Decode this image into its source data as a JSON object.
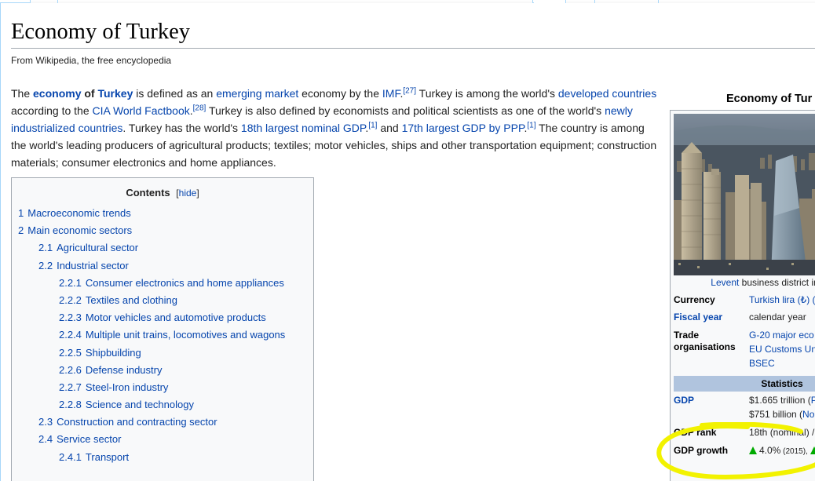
{
  "page": {
    "title": "Economy of Turkey",
    "tagline": "From Wikipedia, the free encyclopedia"
  },
  "lead": {
    "t1": "The ",
    "economy": "economy",
    "of": " of ",
    "turkey": "Turkey",
    "t2": " is defined as an ",
    "emerging_market": "emerging market",
    "t3": " economy by the ",
    "imf": "IMF",
    "ref27": "[27]",
    "t4": " Turkey is among the world's ",
    "developed_countries": "developed countries",
    "t5": " according to the ",
    "cia": "CIA World Factbook",
    "ref28": "[28]",
    "t6": " Turkey is also defined by economists and political scientists as one of the world's ",
    "nic": "newly industrialized countries",
    "t7": ". Turkey has the world's ",
    "nominal": "18th largest nominal GDP",
    "ref1a": "[1]",
    "t8": " and ",
    "ppp": "17th largest GDP by PPP",
    "ref1b": "[1]",
    "t9": " The country is among the world's leading producers of agricultural products; textiles; motor vehicles, ships and other transportation equipment; construction materials; consumer electronics and home appliances.",
    "dot": "."
  },
  "toc": {
    "title": "Contents",
    "toggle_open": "[",
    "toggle": "hide",
    "toggle_close": "]",
    "items": [
      {
        "num": "1",
        "label": "Macroeconomic trends"
      },
      {
        "num": "2",
        "label": "Main economic sectors"
      },
      {
        "num": "2.1",
        "label": "Agricultural sector"
      },
      {
        "num": "2.2",
        "label": "Industrial sector"
      },
      {
        "num": "2.2.1",
        "label": "Consumer electronics and home appliances"
      },
      {
        "num": "2.2.2",
        "label": "Textiles and clothing"
      },
      {
        "num": "2.2.3",
        "label": "Motor vehicles and automotive products"
      },
      {
        "num": "2.2.4",
        "label": "Multiple unit trains, locomotives and wagons"
      },
      {
        "num": "2.2.5",
        "label": "Shipbuilding"
      },
      {
        "num": "2.2.6",
        "label": "Defense industry"
      },
      {
        "num": "2.2.7",
        "label": "Steel-Iron industry"
      },
      {
        "num": "2.2.8",
        "label": "Science and technology"
      },
      {
        "num": "2.3",
        "label": "Construction and contracting sector"
      },
      {
        "num": "2.4",
        "label": "Service sector"
      },
      {
        "num": "2.4.1",
        "label": "Transport"
      }
    ]
  },
  "infobox": {
    "caption": "Economy of Tur",
    "image_caption_link": "Levent",
    "image_caption_text": " business district in",
    "currency_label": "Currency",
    "currency_value": "Turkish lira (₺) (",
    "fiscal_label": "Fiscal year",
    "fiscal_value": "calendar year",
    "trade_label_1": "Trade",
    "trade_label_2": "organisations",
    "trade_value_1": "G-20 major eco",
    "trade_value_2": "EU Customs Un",
    "trade_value_3": "BSEC",
    "stats_header": "Statistics",
    "gdp_label": "GDP",
    "gdp_value_1": "$1.665 trillion (",
    "gdp_value_1_link": "P",
    "gdp_value_2": "$751 billion (",
    "gdp_value_2_link": "No",
    "gdp_rank_label": "GDP rank",
    "gdp_rank_value": "18th (nominal) /",
    "gdp_growth_label": "GDP growth",
    "gdp_growth_value": "4.0%",
    "gdp_growth_year": " (2015), "
  },
  "colors": {
    "link": "#0645ad",
    "stats_header_bg": "#b0c4de",
    "highlight": "#f2f200",
    "growth_arrow": "#00aa00"
  }
}
